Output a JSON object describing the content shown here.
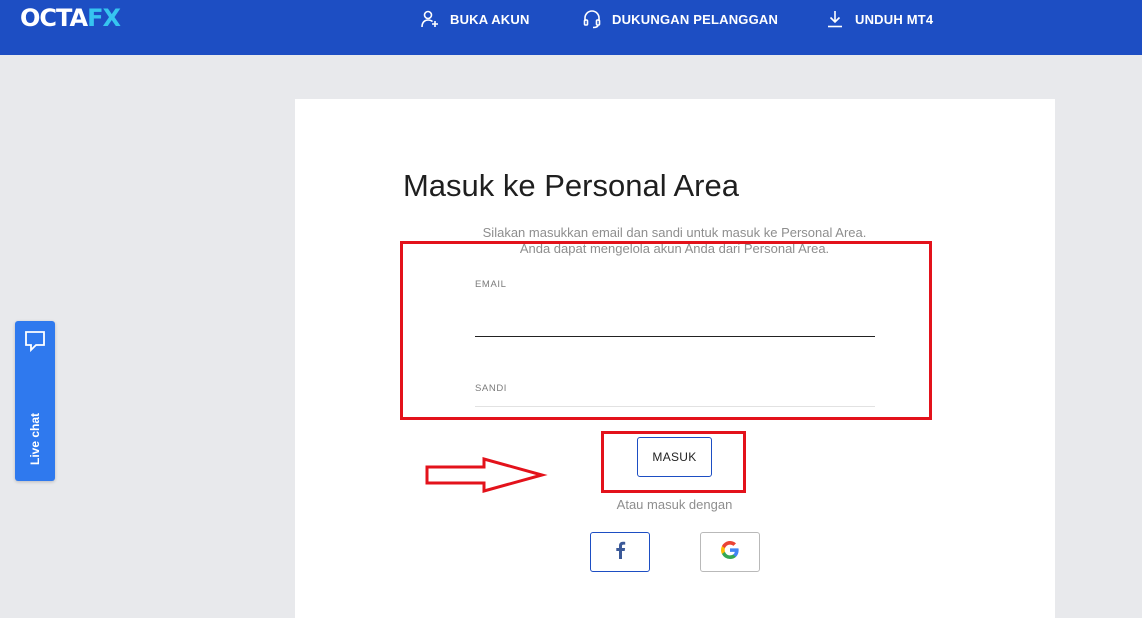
{
  "header": {
    "logo": {
      "part1": "OCTA",
      "part2": "FX"
    },
    "nav": [
      {
        "label": "BUKA AKUN",
        "icon": "add-user-icon"
      },
      {
        "label": "DUKUNGAN PELANGGAN",
        "icon": "headset-icon"
      },
      {
        "label": "UNDUH MT4",
        "icon": "download-icon"
      }
    ]
  },
  "login": {
    "title": "Masuk ke Personal Area",
    "subtitle_line1": "Silakan masukkan email dan sandi untuk masuk ke Personal Area.",
    "subtitle_line2": "Anda dapat mengelola akun Anda dari Personal Area.",
    "email_label": "EMAIL",
    "email_value": "",
    "password_label": "SANDI",
    "password_value": "",
    "submit_label": "MASUK",
    "alt_login_text": "Atau masuk dengan",
    "social": [
      {
        "icon": "facebook-icon"
      },
      {
        "icon": "google-icon"
      }
    ]
  },
  "live_chat": {
    "label": "Live chat",
    "icon": "chat-bubble-icon"
  },
  "colors": {
    "header_bg": "#1d4ec3",
    "annotation_red": "#e3121b",
    "live_chat_bg": "#2f79ee",
    "logo_accent": "#36c5f0"
  }
}
